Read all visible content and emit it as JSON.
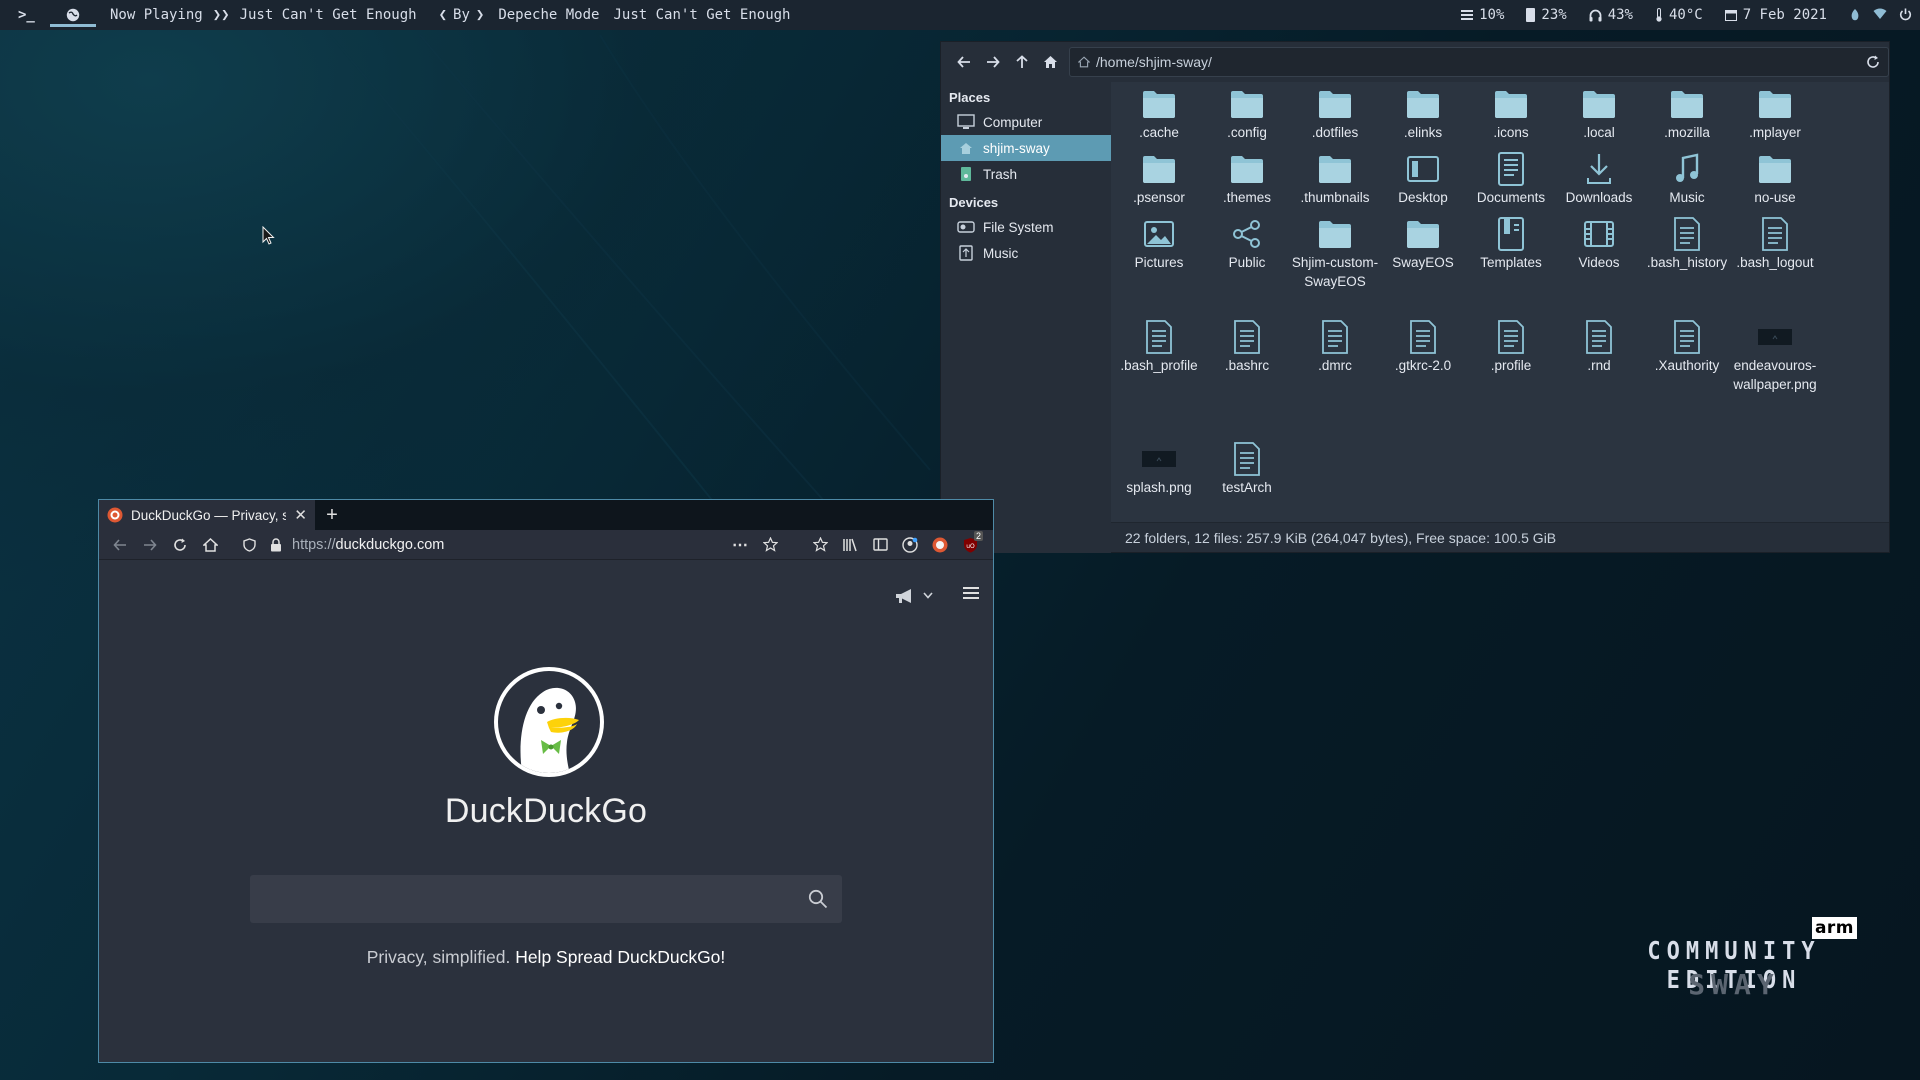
{
  "topbar": {
    "now_playing": "Now Playing",
    "title": "Just Can't Get Enough",
    "by": "By",
    "artist": "Depeche Mode",
    "track": "Just Can't Get Enough",
    "cpu": "10%",
    "memory": "23%",
    "volume": "43%",
    "temperature": "40°C",
    "date": "7 Feb 2021"
  },
  "filemanager": {
    "path": "/home/shjim-sway/",
    "places_heading": "Places",
    "devices_heading": "Devices",
    "places": [
      {
        "label": "Computer",
        "icon": "computer-icon"
      },
      {
        "label": "shjim-sway",
        "icon": "home-folder-icon"
      },
      {
        "label": "Trash",
        "icon": "trash-icon"
      }
    ],
    "devices": [
      {
        "label": "File System",
        "icon": "drive-icon"
      },
      {
        "label": "Music",
        "icon": "usb-drive-icon"
      }
    ],
    "files": [
      {
        "label": ".cache",
        "icon": "folder-icon"
      },
      {
        "label": ".config",
        "icon": "folder-icon"
      },
      {
        "label": ".dotfiles",
        "icon": "folder-icon"
      },
      {
        "label": ".elinks",
        "icon": "folder-icon"
      },
      {
        "label": ".icons",
        "icon": "folder-icon"
      },
      {
        "label": ".local",
        "icon": "folder-icon"
      },
      {
        "label": ".mozilla",
        "icon": "folder-icon"
      },
      {
        "label": ".mplayer",
        "icon": "folder-icon"
      },
      {
        "label": ".psensor",
        "icon": "folder-icon"
      },
      {
        "label": ".themes",
        "icon": "folder-icon"
      },
      {
        "label": ".thumbnails",
        "icon": "folder-icon"
      },
      {
        "label": "Desktop",
        "icon": "desktop-folder-icon"
      },
      {
        "label": "Documents",
        "icon": "documents-folder-icon"
      },
      {
        "label": "Downloads",
        "icon": "downloads-folder-icon"
      },
      {
        "label": "Music",
        "icon": "music-folder-icon"
      },
      {
        "label": "no-use",
        "icon": "folder-icon"
      },
      {
        "label": "Pictures",
        "icon": "pictures-folder-icon"
      },
      {
        "label": "Public",
        "icon": "public-folder-icon"
      },
      {
        "label": "Shjim-custom-SwayEOS",
        "icon": "folder-icon"
      },
      {
        "label": "SwayEOS",
        "icon": "folder-icon"
      },
      {
        "label": "Templates",
        "icon": "templates-folder-icon"
      },
      {
        "label": "Videos",
        "icon": "videos-folder-icon"
      },
      {
        "label": ".bash_history",
        "icon": "text-file-icon"
      },
      {
        "label": ".bash_logout",
        "icon": "text-file-icon"
      },
      {
        "label": ".bash_profile",
        "icon": "text-file-icon"
      },
      {
        "label": ".bashrc",
        "icon": "text-file-icon"
      },
      {
        "label": ".dmrc",
        "icon": "text-file-icon"
      },
      {
        "label": ".gtkrc-2.0",
        "icon": "text-file-icon"
      },
      {
        "label": ".profile",
        "icon": "text-file-icon"
      },
      {
        "label": ".rnd",
        "icon": "text-file-icon"
      },
      {
        "label": ".Xauthority",
        "icon": "text-file-icon"
      },
      {
        "label": "endeavouros-wallpaper.png",
        "icon": "image-thumbnail-icon"
      },
      {
        "label": "splash.png",
        "icon": "image-thumbnail-icon"
      },
      {
        "label": "testArch",
        "icon": "text-file-icon"
      }
    ],
    "status": "22 folders, 12 files: 257.9 KiB (264,047 bytes), Free space: 100.5 GiB"
  },
  "browser": {
    "tab_title": "DuckDuckGo — Privacy, si",
    "url_proto": "https://",
    "url_host": "duckduckgo.com",
    "ublock_count": "2",
    "brand": "DuckDuckGo",
    "search_placeholder": "",
    "tagline": "Privacy, simplified.",
    "tagline_link": "Help Spread DuckDuckGo!"
  },
  "desktop_logo": {
    "badge": "arm",
    "edition": "COMMUNITY EDITION",
    "name": "SWAY"
  },
  "colors": {
    "accent": "#5d9bb3",
    "folder": "#8fc4d6",
    "bar_bg": "#1b2530"
  }
}
